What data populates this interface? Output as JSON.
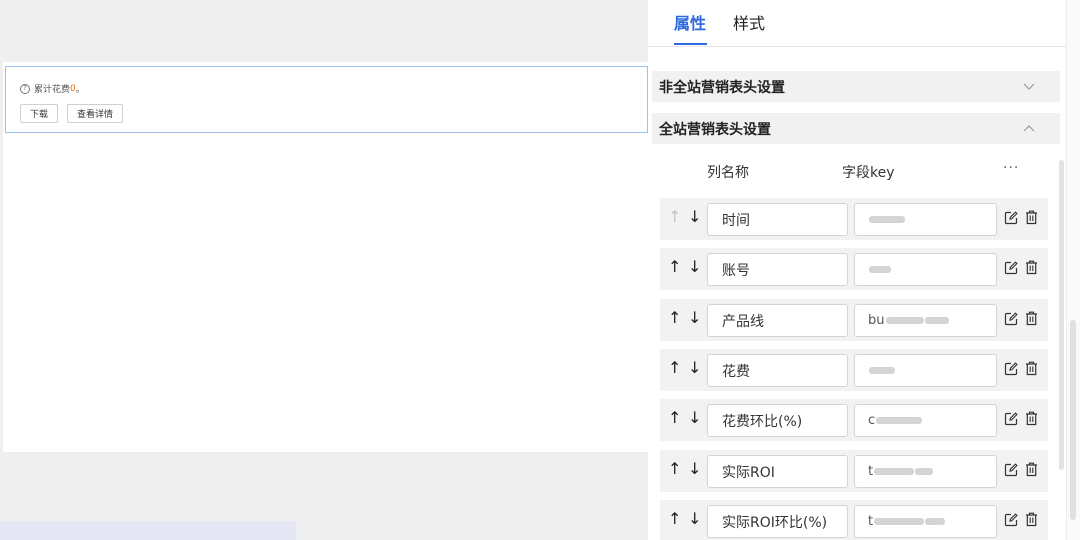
{
  "canvas": {
    "summary_prefix": "累计花费",
    "summary_value": "0",
    "summary_suffix": "。",
    "help_icon": "question-circle-icon",
    "download_label": "下载",
    "details_label": "查看详情"
  },
  "panel": {
    "tabs": [
      {
        "label": "属性",
        "active": true
      },
      {
        "label": "样式",
        "active": false
      }
    ],
    "sections": [
      {
        "label": "非全站营销表头设置",
        "expanded": false,
        "icon": "chevron-down-icon"
      },
      {
        "label": "全站营销表头设置",
        "expanded": true,
        "icon": "chevron-up-icon"
      }
    ],
    "columns_header": {
      "name": "列名称",
      "key": "字段key",
      "more": "···"
    },
    "rows": [
      {
        "name": "时间",
        "key_prefix": "",
        "up_disabled": true
      },
      {
        "name": "账号",
        "key_prefix": "",
        "up_disabled": false
      },
      {
        "name": "产品线",
        "key_prefix": "bu",
        "up_disabled": false
      },
      {
        "name": "花费",
        "key_prefix": "",
        "up_disabled": false
      },
      {
        "name": "花费环比(%)",
        "key_prefix": "c",
        "up_disabled": false
      },
      {
        "name": "实际ROI",
        "key_prefix": "t",
        "up_disabled": false
      },
      {
        "name": "实际ROI环比(%)",
        "key_prefix": "t",
        "up_disabled": false
      }
    ],
    "row_icons": {
      "up": "arrow-up-icon",
      "down": "arrow-down-icon",
      "edit": "edit-icon",
      "delete": "trash-icon"
    },
    "arrow_up_glyph": "↑",
    "arrow_down_glyph": "↓"
  },
  "colors": {
    "accent": "#2d6ae0",
    "highlight_number": "#ef6c00",
    "widget_border": "#9cc3f0"
  }
}
